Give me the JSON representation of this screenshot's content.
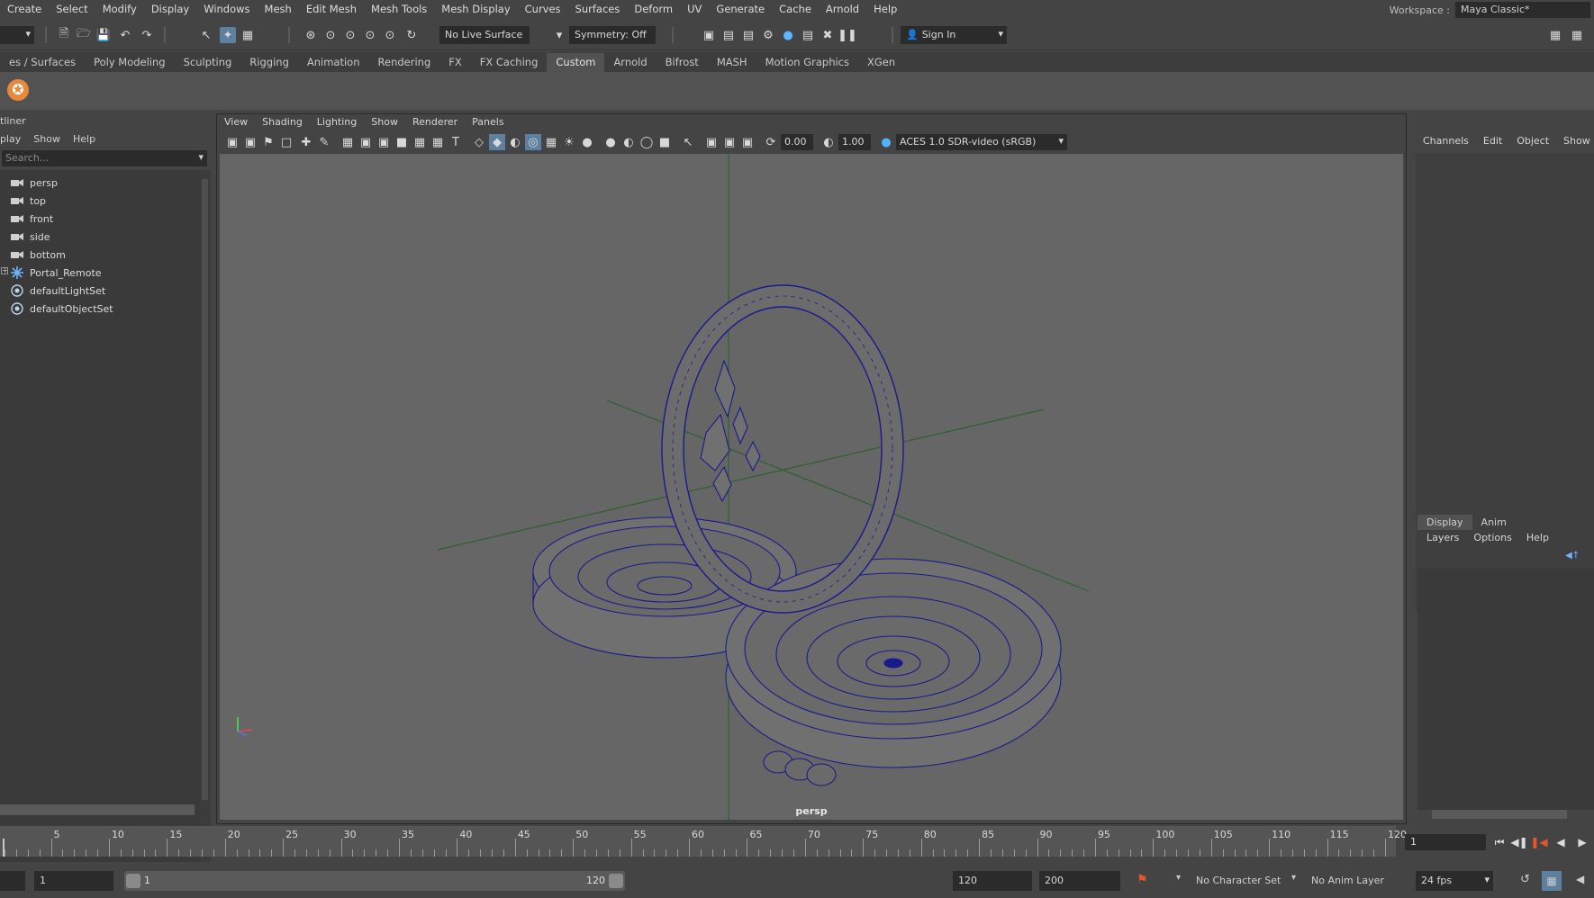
{
  "menubar": {
    "items": [
      "Create",
      "Select",
      "Modify",
      "Display",
      "Windows",
      "Mesh",
      "Edit Mesh",
      "Mesh Tools",
      "Mesh Display",
      "Curves",
      "Surfaces",
      "Deform",
      "UV",
      "Generate",
      "Cache",
      "Arnold",
      "Help"
    ],
    "workspace_label": "Workspace :",
    "workspace_value": "Maya Classic*"
  },
  "statusline": {
    "live_surface": "No Live Surface",
    "symmetry": "Symmetry: Off",
    "sign_in": "Sign In"
  },
  "shelf": {
    "tabs": [
      "es / Surfaces",
      "Poly Modeling",
      "Sculpting",
      "Rigging",
      "Animation",
      "Rendering",
      "FX",
      "FX Caching",
      "Custom",
      "Arnold",
      "Bifrost",
      "MASH",
      "Motion Graphics",
      "XGen"
    ],
    "active_tab": "Custom"
  },
  "outliner": {
    "title": "tliner",
    "menu": [
      "play",
      "Show",
      "Help"
    ],
    "search_placeholder": "Search...",
    "items": [
      {
        "label": "persp",
        "icon": "camera-icon"
      },
      {
        "label": "top",
        "icon": "camera-icon"
      },
      {
        "label": "front",
        "icon": "camera-icon"
      },
      {
        "label": "side",
        "icon": "camera-icon"
      },
      {
        "label": "bottom",
        "icon": "camera-icon"
      },
      {
        "label": "Portal_Remote",
        "icon": "group-icon"
      },
      {
        "label": "defaultLightSet",
        "icon": "set-icon"
      },
      {
        "label": "defaultObjectSet",
        "icon": "set-icon"
      }
    ]
  },
  "viewport": {
    "menu": [
      "View",
      "Shading",
      "Lighting",
      "Show",
      "Renderer",
      "Panels"
    ],
    "exposure": "0.00",
    "gamma": "1.00",
    "color_space": "ACES 1.0 SDR-video (sRGB)",
    "camera_label": "persp"
  },
  "channelbox": {
    "menu": [
      "Channels",
      "Edit",
      "Object",
      "Show"
    ],
    "layer_tabs": [
      "Display",
      "Anim"
    ],
    "layer_menu": [
      "Layers",
      "Options",
      "Help"
    ]
  },
  "timeline": {
    "labels": [
      "5",
      "10",
      "15",
      "20",
      "25",
      "30",
      "35",
      "40",
      "45",
      "50",
      "55",
      "60",
      "65",
      "70",
      "75",
      "80",
      "85",
      "90",
      "95",
      "100",
      "105",
      "110",
      "115",
      "120"
    ],
    "current_frame": "1"
  },
  "range": {
    "start": "1",
    "slider_start": "1",
    "slider_end": "120",
    "end": "120",
    "max_end": "200",
    "character_set": "No Character Set",
    "anim_layer": "No Anim Layer",
    "fps": "24 fps"
  },
  "colors": {
    "wireframe": "#1a1a8c",
    "grid_axis": "#2f5f2f",
    "viewport_bg": "#666666"
  }
}
